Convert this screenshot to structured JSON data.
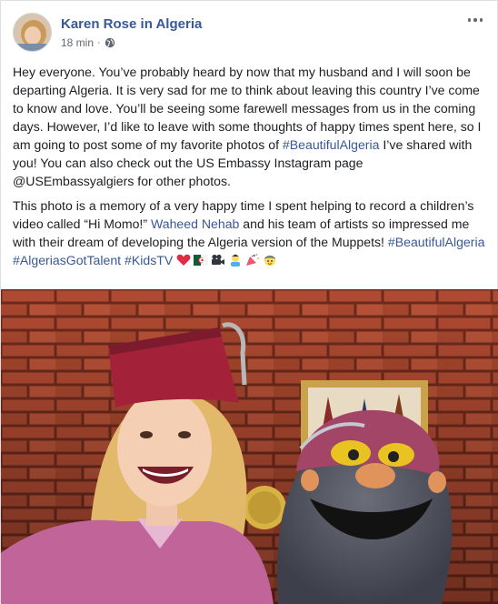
{
  "post": {
    "author": "Karen Rose in Algeria",
    "time": "18 min",
    "dot": "·",
    "paragraph1": {
      "part1": "Hey everyone. You’ve probably heard by now that my husband and I will soon be departing Algeria. It is very sad for me to think about leaving this country I’ve come to know and love. You’ll be seeing some farewell messages from us in the coming days. However, I’d like to leave with some thoughts of happy times spent here, so I am going to post some of my favorite photos of ",
      "hashtag": "#BeautifulAlgeria",
      "part2": " I’ve shared with you! You can also check out the US Embassy Instagram page @USEmbassyalgiers for other photos."
    },
    "paragraph2": {
      "part1": "This photo is a memory of a very happy time I spent helping to record a children’s video called “Hi Momo!” ",
      "mention": "Waheed Nehab",
      "part2": " and his team of artists so impressed me with their dream of developing the Algeria version of the Muppets! ",
      "hashtags": [
        "#BeautifulAlgeria",
        "#AlgeriasGotTalent",
        "#KidsTV"
      ]
    },
    "emojis": [
      "red-heart-icon",
      "algeria-flag-icon",
      "movie-camera-icon",
      "artist-icon",
      "party-popper-icon",
      "kid-face-icon"
    ],
    "colors": {
      "link": "#385898",
      "text": "#1c1e21",
      "meta": "#616770",
      "brick": "#a8472e"
    }
  }
}
